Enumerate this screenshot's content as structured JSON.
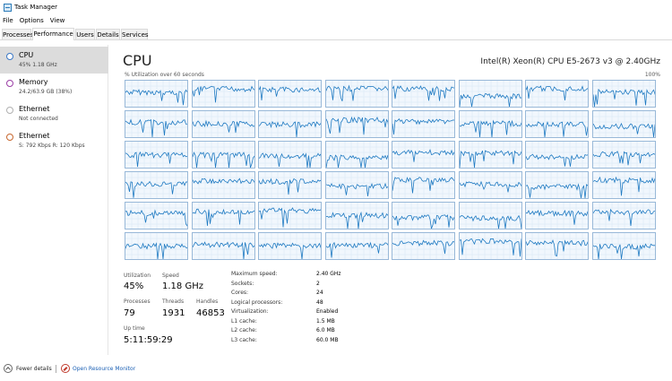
{
  "window": {
    "title": "Task Manager"
  },
  "menu": [
    "File",
    "Options",
    "View"
  ],
  "tabs": [
    "Processes",
    "Performance",
    "Users",
    "Details",
    "Services"
  ],
  "active_tab": 1,
  "sidebar": [
    {
      "title": "CPU",
      "subtitle": "45% 1.18 GHz",
      "color": "#3b78c6",
      "selected": true
    },
    {
      "title": "Memory",
      "subtitle": "24.2/63.9 GB (38%)",
      "color": "#9b3ea6",
      "selected": false
    },
    {
      "title": "Ethernet",
      "subtitle": "Not connected",
      "color": "#b0b0b0",
      "selected": false
    },
    {
      "title": "Ethernet",
      "subtitle": "S: 792 Kbps R: 120 Kbps",
      "color": "#c7672e",
      "selected": false
    }
  ],
  "cpu": {
    "heading": "CPU",
    "model": "Intel(R) Xeon(R) CPU E5-2673 v3 @ 2.40GHz",
    "graph_label": "% Utilization over 60 seconds",
    "graph_max": "100%",
    "core_count": 48,
    "line_color": "#1f7ac2"
  },
  "stats": {
    "utilization_label": "Utilization",
    "utilization": "45%",
    "speed_label": "Speed",
    "speed": "1.18 GHz",
    "processes_label": "Processes",
    "processes": "79",
    "threads_label": "Threads",
    "threads": "1931",
    "handles_label": "Handles",
    "handles": "46853",
    "uptime_label": "Up time",
    "uptime": "5:11:59:29"
  },
  "specs": [
    {
      "label": "Maximum speed:",
      "value": "2.40 GHz"
    },
    {
      "label": "Sockets:",
      "value": "2"
    },
    {
      "label": "Cores:",
      "value": "24"
    },
    {
      "label": "Logical processors:",
      "value": "48"
    },
    {
      "label": "Virtualization:",
      "value": "Enabled"
    },
    {
      "label": "L1 cache:",
      "value": "1.5 MB"
    },
    {
      "label": "L2 cache:",
      "value": "6.0 MB"
    },
    {
      "label": "L3 cache:",
      "value": "60.0 MB"
    }
  ],
  "footer": {
    "fewer_details": "Fewer details",
    "resource_monitor": "Open Resource Monitor"
  }
}
